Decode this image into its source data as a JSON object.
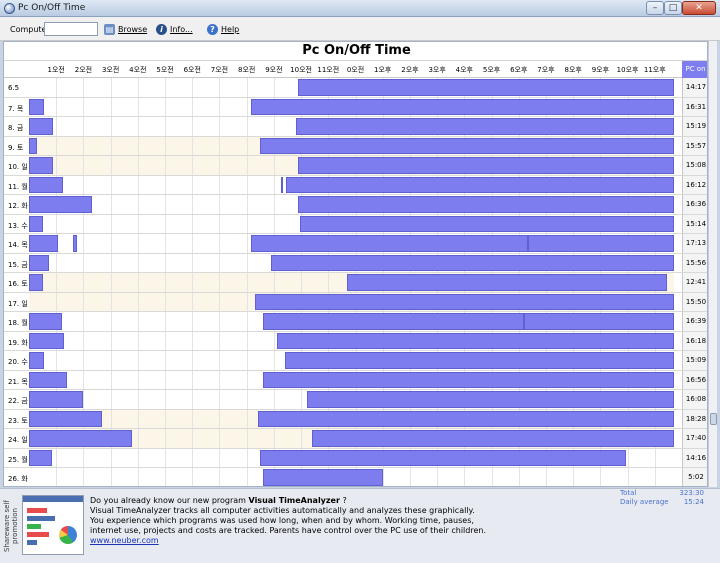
{
  "window": {
    "title": "Pc On/Off Time",
    "min": "–",
    "max": "□",
    "close": "✕"
  },
  "toolbar": {
    "computer_label": "Computer",
    "computer_value": "",
    "browse_label": "Browse",
    "info_label": "Info...",
    "help_label": "Help"
  },
  "chart_data": {
    "type": "table",
    "title": "Pc On/Off Time",
    "total_column_label": "PC on",
    "hour_labels": [
      "1오전",
      "2오전",
      "3오전",
      "4오전",
      "5오전",
      "6오전",
      "7오전",
      "8오전",
      "9오전",
      "10오전",
      "11오전",
      "0오전",
      "1오후",
      "2오후",
      "3오후",
      "4오후",
      "5오후",
      "6오후",
      "7오후",
      "8오후",
      "9오후",
      "10오후",
      "11오후"
    ],
    "rows": [
      {
        "label": "6.5",
        "total": "14:17",
        "shade": null,
        "intervals": [
          [
            9.9,
            23.7
          ]
        ]
      },
      {
        "label": "7. 목",
        "total": "16:31",
        "shade": null,
        "intervals": [
          [
            0.0,
            0.55
          ],
          [
            8.15,
            23.7
          ]
        ]
      },
      {
        "label": "8. 금",
        "total": "15:19",
        "shade": null,
        "intervals": [
          [
            0.0,
            0.9
          ],
          [
            9.8,
            23.7
          ]
        ]
      },
      {
        "label": "9. 토",
        "total": "15:57",
        "shade": [
          0.0,
          23.7
        ],
        "intervals": [
          [
            0.0,
            0.3
          ],
          [
            8.5,
            23.7
          ]
        ]
      },
      {
        "label": "10. 일",
        "total": "15:08",
        "shade": [
          0.0,
          23.7
        ],
        "intervals": [
          [
            0.0,
            0.9
          ],
          [
            9.9,
            23.7
          ]
        ]
      },
      {
        "label": "11. 월",
        "total": "16:12",
        "shade": null,
        "intervals": [
          [
            0.0,
            1.25
          ],
          [
            9.25,
            9.35
          ],
          [
            9.45,
            23.7
          ]
        ]
      },
      {
        "label": "12. 화",
        "total": "16:36",
        "shade": null,
        "intervals": [
          [
            0.0,
            2.3
          ],
          [
            9.9,
            23.7
          ]
        ]
      },
      {
        "label": "13. 수",
        "total": "15:14",
        "shade": null,
        "intervals": [
          [
            0.0,
            0.5
          ],
          [
            9.95,
            23.7
          ]
        ]
      },
      {
        "label": "14. 목",
        "total": "17:13",
        "shade": null,
        "intervals": [
          [
            0.0,
            1.05
          ],
          [
            1.6,
            1.75
          ],
          [
            8.15,
            18.35
          ],
          [
            18.35,
            23.7
          ]
        ]
      },
      {
        "label": "15. 금",
        "total": "15:56",
        "shade": null,
        "intervals": [
          [
            0.0,
            0.75
          ],
          [
            8.9,
            23.7
          ]
        ]
      },
      {
        "label": "16. 토",
        "total": "12:41",
        "shade": [
          0.0,
          23.7
        ],
        "intervals": [
          [
            0.0,
            0.5
          ],
          [
            11.7,
            23.45
          ]
        ]
      },
      {
        "label": "17. 일",
        "total": "15:50",
        "shade": [
          0.0,
          23.7
        ],
        "intervals": [
          [
            8.3,
            23.7
          ]
        ]
      },
      {
        "label": "18. 월",
        "total": "16:39",
        "shade": null,
        "intervals": [
          [
            0.0,
            1.2
          ],
          [
            8.6,
            18.2
          ],
          [
            18.2,
            23.7
          ]
        ]
      },
      {
        "label": "19. 화",
        "total": "16:18",
        "shade": null,
        "intervals": [
          [
            0.0,
            1.3
          ],
          [
            9.1,
            23.7
          ]
        ]
      },
      {
        "label": "20. 수",
        "total": "15:09",
        "shade": null,
        "intervals": [
          [
            0.0,
            0.55
          ],
          [
            9.4,
            23.7
          ]
        ]
      },
      {
        "label": "21. 목",
        "total": "16:56",
        "shade": null,
        "intervals": [
          [
            0.0,
            1.4
          ],
          [
            8.6,
            23.7
          ]
        ]
      },
      {
        "label": "22. 금",
        "total": "16:08",
        "shade": null,
        "intervals": [
          [
            0.0,
            2.0
          ],
          [
            10.2,
            23.7
          ]
        ]
      },
      {
        "label": "23. 토",
        "total": "18:28",
        "shade": [
          0.0,
          23.7
        ],
        "intervals": [
          [
            0.0,
            2.7
          ],
          [
            8.4,
            23.7
          ]
        ]
      },
      {
        "label": "24. 일",
        "total": "17:40",
        "shade": [
          0.0,
          23.7
        ],
        "intervals": [
          [
            0.0,
            3.8
          ],
          [
            10.4,
            23.7
          ]
        ]
      },
      {
        "label": "25. 월",
        "total": "14:16",
        "shade": null,
        "intervals": [
          [
            0.0,
            0.85
          ],
          [
            8.5,
            21.95
          ]
        ]
      },
      {
        "label": "26. 화",
        "total": "5:02",
        "shade": null,
        "intervals": [
          [
            8.6,
            13.0
          ]
        ]
      }
    ]
  },
  "stats": {
    "total_label": "Total",
    "total_value": "323:30",
    "avg_label": "Daily average",
    "avg_value": "15:24"
  },
  "promo": {
    "side_label": "Shareware self promotion",
    "line1_prefix": "Do you already know our new program ",
    "line1_bold": "Visual TimeAnalyzer",
    "line1_suffix": " ?",
    "line2": "Visual TimeAnalyzer tracks all computer activities automatically and analyzes these graphically.",
    "line3": "You experience which programs was used how long, when and by whom. Working time, pauses,",
    "line4": "internet use, projects and costs are tracked. Parents have control over the PC use of their children.",
    "link": "www.neuber.com"
  }
}
